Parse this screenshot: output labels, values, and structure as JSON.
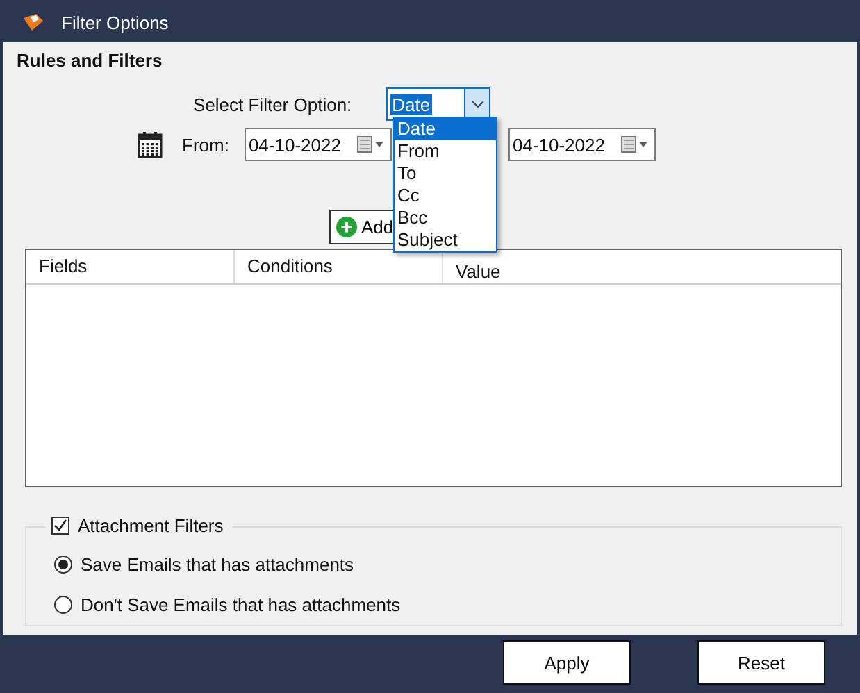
{
  "window": {
    "title": "Filter Options"
  },
  "section_title": "Rules and Filters",
  "filter_option": {
    "label": "Select Filter Option:",
    "value": "Date",
    "expanded": true,
    "options": [
      {
        "label": "Date",
        "selected": true
      },
      {
        "label": "From",
        "selected": false
      },
      {
        "label": "To",
        "selected": false
      },
      {
        "label": "Cc",
        "selected": false
      },
      {
        "label": "Bcc",
        "selected": false
      },
      {
        "label": "Subject",
        "selected": false
      }
    ]
  },
  "date_range": {
    "from_label": "From:",
    "from_value": "04-10-2022",
    "to_value": "04-10-2022"
  },
  "add_button": "Add",
  "table": {
    "columns": [
      "Fields",
      "Conditions",
      "Value"
    ]
  },
  "attachment_filters": {
    "label": "Attachment Filters",
    "checked": true,
    "options": [
      {
        "label": "Save Emails that has attachments",
        "selected": true
      },
      {
        "label": "Don't Save Emails that has attachments",
        "selected": false
      }
    ]
  },
  "buttons": [
    "Apply",
    "Reset"
  ]
}
